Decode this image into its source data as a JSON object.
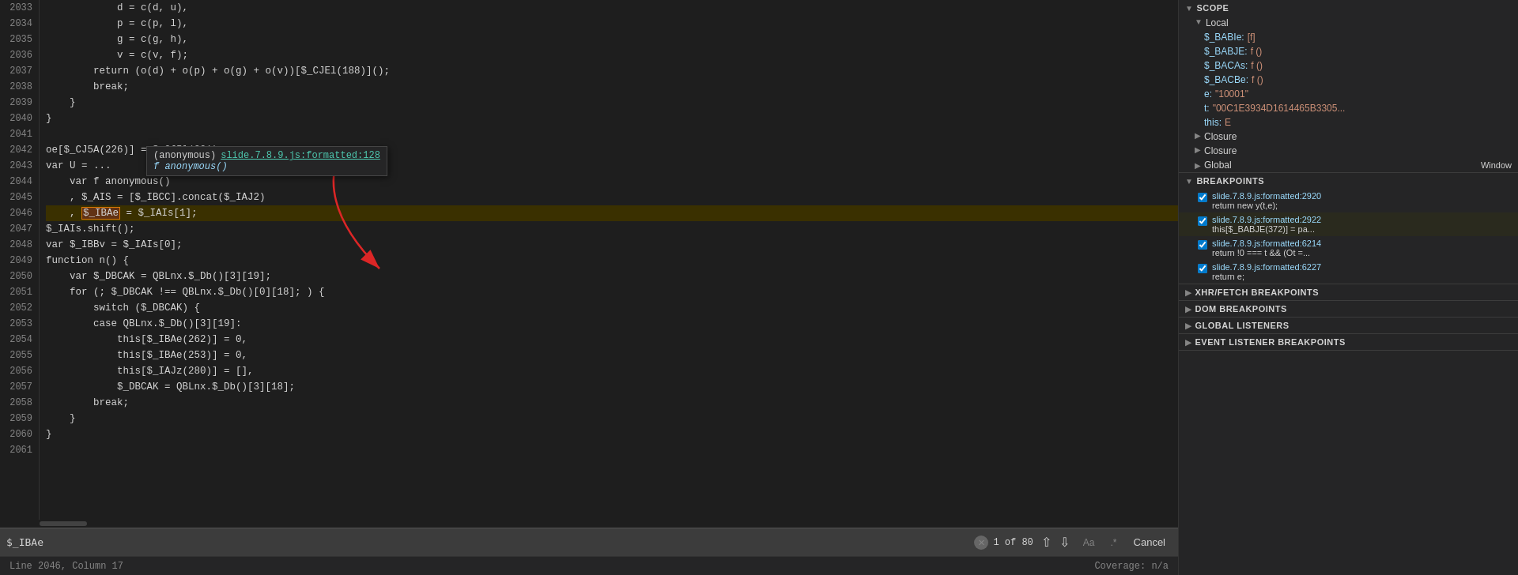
{
  "code": {
    "lines": [
      {
        "num": 2033,
        "text": "            d = c(d, u),",
        "type": "normal"
      },
      {
        "num": 2034,
        "text": "            p = c(p, l),",
        "type": "normal"
      },
      {
        "num": 2035,
        "text": "            g = c(g, h),",
        "type": "normal"
      },
      {
        "num": 2036,
        "text": "            v = c(v, f);",
        "type": "normal"
      },
      {
        "num": 2037,
        "text": "        return (o(d) + o(p) + o(g) + o(v))[$_CJEl(188)]();",
        "type": "normal"
      },
      {
        "num": 2038,
        "text": "        break;",
        "type": "normal"
      },
      {
        "num": 2039,
        "text": "    }",
        "type": "normal"
      },
      {
        "num": 2040,
        "text": "}",
        "type": "normal"
      },
      {
        "num": 2041,
        "text": "",
        "type": "normal"
      },
      {
        "num": 2042,
        "text": "oe[$_CJ5A(226)] = $_CJ5l(201);",
        "type": "normal"
      },
      {
        "num": 2043,
        "text": "var U = ...",
        "type": "normal"
      },
      {
        "num": 2044,
        "text": "    var f anonymous()",
        "type": "normal"
      },
      {
        "num": 2045,
        "text": "    , $_AIS = [$_IBCC].concat($_IAJ2)",
        "type": "normal"
      },
      {
        "num": 2046,
        "text": "    , $_IBAe = $_IAIs[1];",
        "type": "highlighted"
      },
      {
        "num": 2047,
        "text": "$_IAIs.shift();",
        "type": "normal"
      },
      {
        "num": 2048,
        "text": "var $_IBBv = $_IAIs[0];",
        "type": "normal"
      },
      {
        "num": 2049,
        "text": "function n() {",
        "type": "normal"
      },
      {
        "num": 2050,
        "text": "    var $_DBCAK = QBLnx.$_Db()[3][19];",
        "type": "normal"
      },
      {
        "num": 2051,
        "text": "    for (; $_DBCAK !== QBLnx.$_Db()[0][18]; ) {",
        "type": "normal"
      },
      {
        "num": 2052,
        "text": "        switch ($_DBCAK) {",
        "type": "normal"
      },
      {
        "num": 2053,
        "text": "        case QBLnx.$_Db()[3][19]:",
        "type": "normal"
      },
      {
        "num": 2054,
        "text": "            this[$_IBAe(262)] = 0,",
        "type": "normal"
      },
      {
        "num": 2055,
        "text": "            this[$_IBAe(253)] = 0,",
        "type": "normal"
      },
      {
        "num": 2056,
        "text": "            this[$_IAJz(280)] = [],",
        "type": "normal"
      },
      {
        "num": 2057,
        "text": "            $_DBCAK = QBLnx.$_Db()[3][18];",
        "type": "normal"
      },
      {
        "num": 2058,
        "text": "        break;",
        "type": "normal"
      },
      {
        "num": 2059,
        "text": "    }",
        "type": "normal"
      },
      {
        "num": 2060,
        "text": "}",
        "type": "normal"
      },
      {
        "num": 2061,
        "text": "",
        "type": "normal"
      }
    ]
  },
  "tooltip": {
    "label": "(anonymous)",
    "link": "slide.7.8.9.js:formatted:128",
    "body": "f anonymous()"
  },
  "search": {
    "value": "$_IBAe",
    "placeholder": "",
    "count_current": "1",
    "count_total": "of 80",
    "option_aa": "Aa",
    "option_regex": ".*",
    "cancel_label": "Cancel"
  },
  "statusbar": {
    "position": "Line 2046, Column 17",
    "coverage": "Coverage: n/a"
  },
  "debugger": {
    "scope_label": "Scope",
    "local_label": "Local",
    "scope_items": [
      {
        "name": "$_BABIe:",
        "value": "[f]",
        "indent": 1
      },
      {
        "name": "$_BABJE:",
        "value": "f ()",
        "indent": 1
      },
      {
        "name": "$_BACAs:",
        "value": "f ()",
        "indent": 1
      },
      {
        "name": "$_BACBe:",
        "value": "f ()",
        "indent": 1
      },
      {
        "name": "e:",
        "value": "\"10001\"",
        "indent": 1
      },
      {
        "name": "t:",
        "value": "\"00C1E3934D1614465B3305...",
        "indent": 1
      },
      {
        "name": "this:",
        "value": "E",
        "indent": 1
      }
    ],
    "closure_label": "Closure",
    "closure2_label": "Closure",
    "global_label": "Global",
    "global_value": "Window",
    "breakpoints_label": "Breakpoints",
    "breakpoints": [
      {
        "location": "slide.7.8.9.js:formatted:2920",
        "code": "return new y(t,e);",
        "active": false,
        "checked": true
      },
      {
        "location": "slide.7.8.9.js:formatted:2922",
        "code": "this[$_BABJE(372)] = pa...",
        "active": true,
        "checked": true
      },
      {
        "location": "slide.7.8.9.js:formatted:6214",
        "code": "return !0 === t && (Ot =...",
        "active": false,
        "checked": true
      },
      {
        "location": "slide.7.8.9.js:formatted:6227",
        "code": "return e;",
        "active": false,
        "checked": true
      }
    ],
    "xhr_label": "XHR/fetch Breakpoints",
    "dom_label": "DOM Breakpoints",
    "global_listeners_label": "Global Listeners",
    "event_listeners_label": "Event Listener Breakpoints"
  },
  "icons": {
    "collapse_open": "▼",
    "collapse_closed": "▶",
    "triangle_right": "▶"
  }
}
